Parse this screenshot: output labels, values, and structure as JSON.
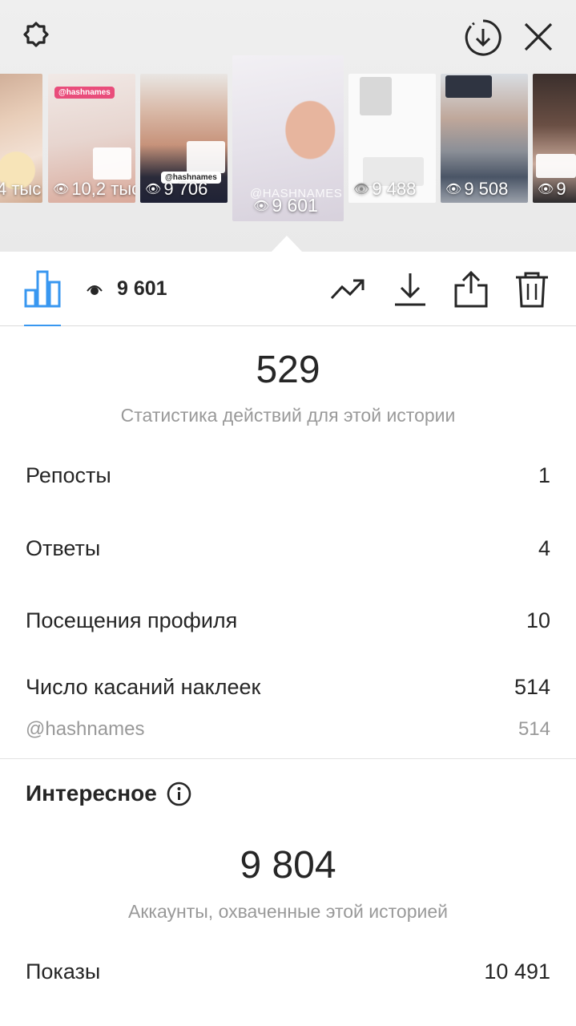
{
  "top_bar": {
    "settings_icon": "gear-icon",
    "download_all_icon": "circle-download-icon",
    "close_icon": "close-icon"
  },
  "stories": [
    {
      "views": "4 тыс",
      "tag": ""
    },
    {
      "views": "10,2 тыс",
      "tag": ""
    },
    {
      "views": "9 706",
      "tag": ""
    },
    {
      "views": "9 601",
      "tag": "@HASHNAMES",
      "active": true
    },
    {
      "views": "9 488",
      "tag": ""
    },
    {
      "views": "9 508",
      "tag": ""
    },
    {
      "views": "9",
      "tag": ""
    }
  ],
  "stickers": {
    "s1": "@hashnames",
    "s2": "@hashnames"
  },
  "toolbar": {
    "views": "9 601",
    "chart_icon": "bar-chart-icon",
    "eye_icon": "eye-icon",
    "promote_icon": "trending-up-icon",
    "download_icon": "download-icon",
    "share_icon": "share-icon",
    "delete_icon": "trash-icon",
    "accent_color": "#3897f0"
  },
  "interactions": {
    "total": "529",
    "caption": "Статистика действий для этой истории",
    "rows": [
      {
        "label": "Репосты",
        "value": "1"
      },
      {
        "label": "Ответы",
        "value": "4"
      },
      {
        "label": "Посещения профиля",
        "value": "10"
      },
      {
        "label": "Число касаний наклеек",
        "value": "514"
      }
    ],
    "sticker_row": {
      "label": "@hashnames",
      "value": "514"
    }
  },
  "discovery": {
    "title": "Интересное",
    "info_icon": "info-icon",
    "reach": "9 804",
    "caption": "Аккаунты, охваченные этой историей",
    "impressions": {
      "label": "Показы",
      "value": "10 491"
    }
  }
}
